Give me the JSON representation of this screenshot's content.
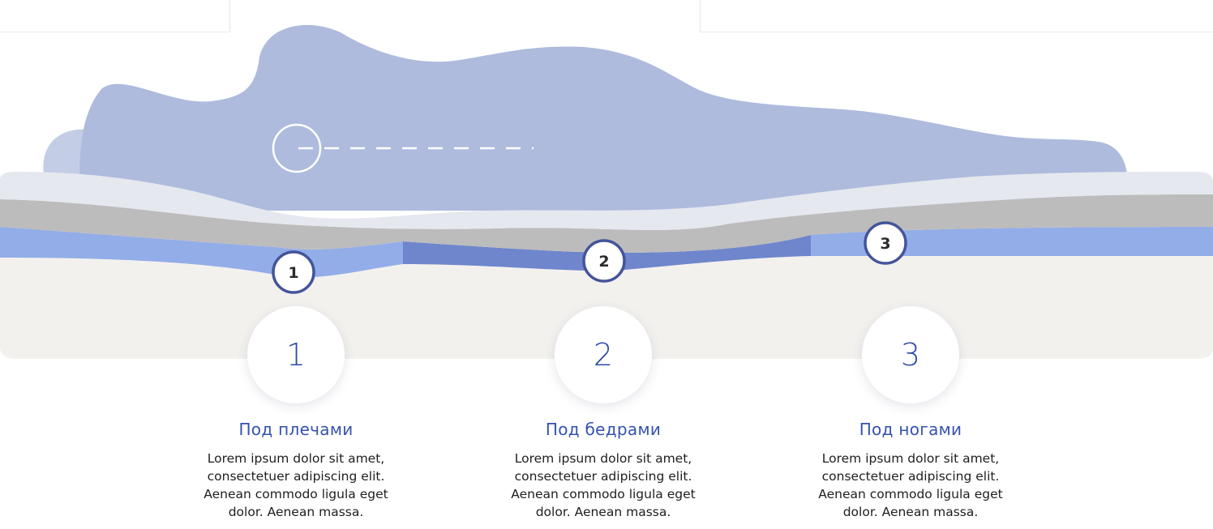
{
  "markers": [
    "1",
    "2",
    "3"
  ],
  "steps": [
    {
      "number": "1",
      "title": "Под плечами",
      "text": "Lorem ipsum dolor sit amet, consectetuer adipiscing elit. Aenean commodo ligula eget dolor. Aenean massa."
    },
    {
      "number": "2",
      "title": "Под бедрами",
      "text": "Lorem ipsum dolor sit amet, consectetuer adipiscing elit. Aenean commodo ligula eget dolor. Aenean massa."
    },
    {
      "number": "3",
      "title": "Под ногами",
      "text": "Lorem ipsum dolor sit amet, consectetuer adipiscing elit. Aenean commodo ligula eget dolor. Aenean massa."
    }
  ],
  "colors": {
    "accent": "#3552b0",
    "body_silhouette": "#aebbdd",
    "blue_layer": "#93ade8",
    "dark_blue_layer": "#6f86cc",
    "grey_layer": "#bcbcbc",
    "top_layer": "#e6e8ef",
    "base_layer": "#f3f1ee",
    "marker_border": "#44549a"
  }
}
